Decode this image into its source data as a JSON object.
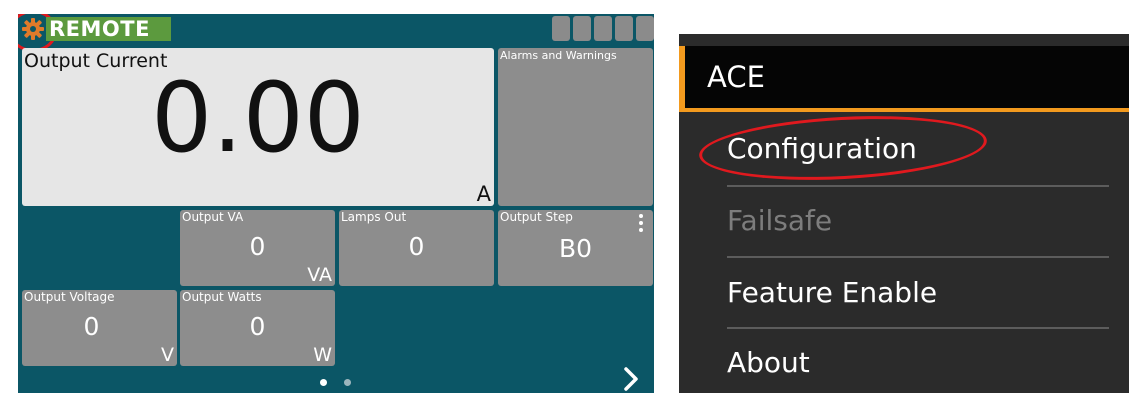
{
  "device_screen": {
    "mode_badge": "REMOTE",
    "main": {
      "title": "Output Current",
      "value": "0.00",
      "unit": "A"
    },
    "tiles": [
      {
        "id": "alarms",
        "title": "Alarms and Warnings",
        "value": "",
        "unit": ""
      },
      {
        "id": "output_va",
        "title": "Output VA",
        "value": "0",
        "unit": "VA"
      },
      {
        "id": "lamps_out",
        "title": "Lamps Out",
        "value": "0",
        "unit": ""
      },
      {
        "id": "output_step",
        "title": "Output Step",
        "value": "B0",
        "unit": ""
      },
      {
        "id": "output_voltage",
        "title": "Output Voltage",
        "value": "0",
        "unit": "V"
      },
      {
        "id": "output_watts",
        "title": "Output Watts",
        "value": "0",
        "unit": "W"
      }
    ],
    "pager": {
      "pages": 2,
      "current": 1
    },
    "colors": {
      "background": "#0b5666",
      "tile": "#8d8d8d",
      "main_tile": "#e6e6e6",
      "remote_badge": "#5c9a3e",
      "highlight_circle": "#e0191e"
    },
    "icons": {
      "settings": "gear-icon",
      "next": "chevron-right-icon",
      "more": "kebab-menu-icon"
    }
  },
  "menu": {
    "header": "ACE",
    "items": [
      {
        "label": "Configuration",
        "enabled": true,
        "highlighted": true
      },
      {
        "label": "Failsafe",
        "enabled": false
      },
      {
        "label": "Feature Enable",
        "enabled": true
      },
      {
        "label": "About",
        "enabled": true
      }
    ],
    "colors": {
      "background": "#2b2b2b",
      "header": "#050505",
      "accent": "#f29a1e",
      "disabled_text": "#7d7d7d",
      "highlight_oval": "#e0191e"
    }
  }
}
